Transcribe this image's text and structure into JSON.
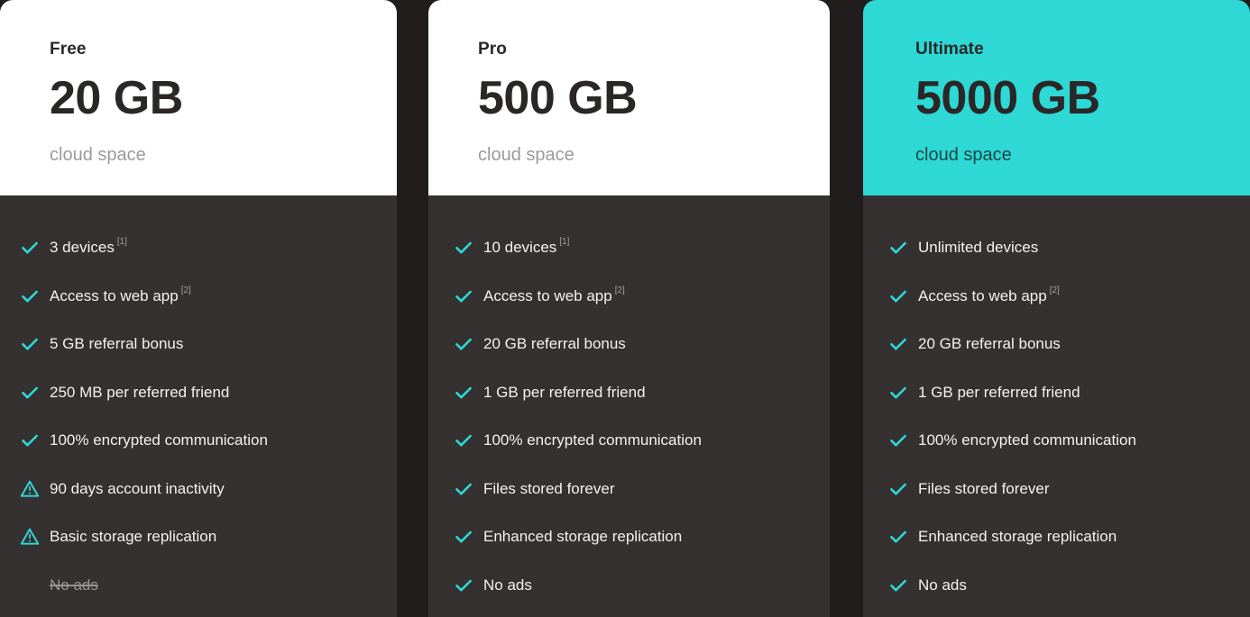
{
  "theme": {
    "page_background": "#211d1d",
    "card_background": "#353131",
    "header_light": "#ffffff",
    "header_accent": "#2dd8d5",
    "accent": "#2dd8d5",
    "check_color": "#2dd8d5",
    "warn_color": "#2dd8d5",
    "text_primary": "#f2f2f2",
    "text_dark": "#2b2727",
    "text_muted": "#9a9a9a",
    "strike_color": "#999494"
  },
  "plans": [
    {
      "name": "Free",
      "size": "20 GB",
      "subtitle": "cloud space",
      "highlighted": false,
      "features": [
        {
          "icon": "check-icon",
          "label": "3 devices",
          "note": "[1]",
          "state": "included"
        },
        {
          "icon": "check-icon",
          "label": "Access to web app",
          "note": "[2]",
          "state": "included"
        },
        {
          "icon": "check-icon",
          "label": "5 GB referral bonus",
          "note": "",
          "state": "included"
        },
        {
          "icon": "check-icon",
          "label": "250 MB per referred friend",
          "note": "",
          "state": "included"
        },
        {
          "icon": "check-icon",
          "label": "100% encrypted communication",
          "note": "",
          "state": "included"
        },
        {
          "icon": "warning-icon",
          "label": "90 days account inactivity",
          "note": "",
          "state": "warning"
        },
        {
          "icon": "warning-icon",
          "label": "Basic storage replication",
          "note": "",
          "state": "warning"
        },
        {
          "icon": "none",
          "label": "No ads",
          "note": "",
          "state": "excluded"
        }
      ]
    },
    {
      "name": "Pro",
      "size": "500 GB",
      "subtitle": "cloud space",
      "highlighted": false,
      "features": [
        {
          "icon": "check-icon",
          "label": "10 devices",
          "note": "[1]",
          "state": "included"
        },
        {
          "icon": "check-icon",
          "label": "Access to web app",
          "note": "[2]",
          "state": "included"
        },
        {
          "icon": "check-icon",
          "label": "20 GB referral bonus",
          "note": "",
          "state": "included"
        },
        {
          "icon": "check-icon",
          "label": "1 GB per referred friend",
          "note": "",
          "state": "included"
        },
        {
          "icon": "check-icon",
          "label": "100% encrypted communication",
          "note": "",
          "state": "included"
        },
        {
          "icon": "check-icon",
          "label": "Files stored forever",
          "note": "",
          "state": "included"
        },
        {
          "icon": "check-icon",
          "label": "Enhanced storage replication",
          "note": "",
          "state": "included"
        },
        {
          "icon": "check-icon",
          "label": "No ads",
          "note": "",
          "state": "included"
        }
      ]
    },
    {
      "name": "Ultimate",
      "size": "5000 GB",
      "subtitle": "cloud space",
      "highlighted": true,
      "features": [
        {
          "icon": "check-icon",
          "label": "Unlimited devices",
          "note": "",
          "state": "included"
        },
        {
          "icon": "check-icon",
          "label": "Access to web app",
          "note": "[2]",
          "state": "included"
        },
        {
          "icon": "check-icon",
          "label": "20 GB referral bonus",
          "note": "",
          "state": "included"
        },
        {
          "icon": "check-icon",
          "label": "1 GB per referred friend",
          "note": "",
          "state": "included"
        },
        {
          "icon": "check-icon",
          "label": "100% encrypted communication",
          "note": "",
          "state": "included"
        },
        {
          "icon": "check-icon",
          "label": "Files stored forever",
          "note": "",
          "state": "included"
        },
        {
          "icon": "check-icon",
          "label": "Enhanced storage replication",
          "note": "",
          "state": "included"
        },
        {
          "icon": "check-icon",
          "label": "No ads",
          "note": "",
          "state": "included"
        }
      ]
    }
  ]
}
